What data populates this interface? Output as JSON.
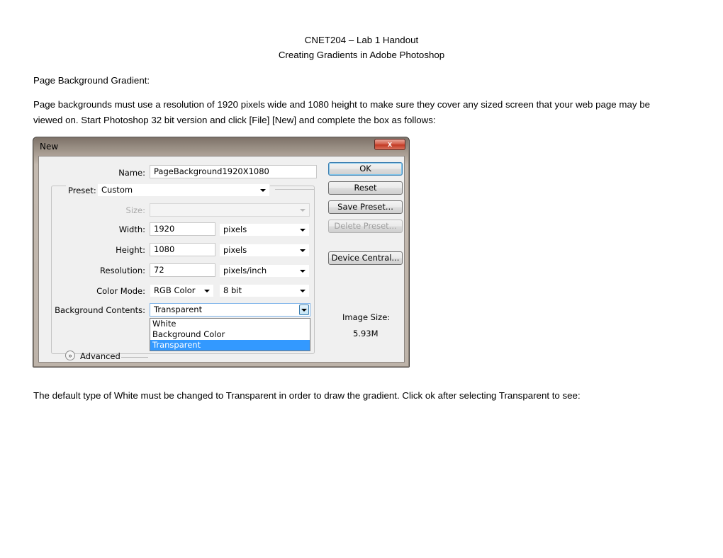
{
  "document": {
    "title_line1": "CNET204 – Lab 1 Handout",
    "title_line2": "Creating Gradients in Adobe Photoshop",
    "section_heading": "Page Background Gradient:",
    "para1_line1": "Page backgrounds must use a resolution of 1920 pixels wide and 1080 height to make sure they cover any sized screen that your web page may be",
    "para1_line2": "viewed on. Start Photoshop 32 bit version and click [File] [New] and complete the box as follows:",
    "para2": "The default type of White must be changed to Transparent in order to draw the gradient. Click ok after selecting Transparent to see:"
  },
  "dialog": {
    "title": "New",
    "close_glyph": "x",
    "name_label": "Name:",
    "name_value": "PageBackground1920X1080",
    "preset_label": "Preset:",
    "preset_value": "Custom",
    "size_label": "Size:",
    "size_value": "",
    "width_label": "Width:",
    "width_value": "1920",
    "width_unit": "pixels",
    "height_label": "Height:",
    "height_value": "1080",
    "height_unit": "pixels",
    "resolution_label": "Resolution:",
    "resolution_value": "72",
    "resolution_unit": "pixels/inch",
    "color_mode_label": "Color Mode:",
    "color_mode_value": "RGB Color",
    "bit_depth_value": "8 bit",
    "bg_contents_label": "Background Contents:",
    "bg_contents_value": "Transparent",
    "bg_options": [
      "White",
      "Background Color",
      "Transparent"
    ],
    "advanced_label": "Advanced",
    "image_size_label": "Image Size:",
    "image_size_value": "5.93M",
    "buttons": {
      "ok": "OK",
      "reset": "Reset",
      "save_preset": "Save Preset...",
      "delete_preset": "Delete Preset...",
      "device_central": "Device Central..."
    }
  }
}
